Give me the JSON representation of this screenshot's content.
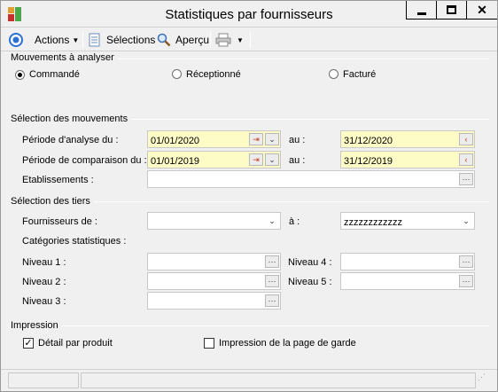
{
  "window": {
    "title": "Statistiques par fournisseurs"
  },
  "toolbar": {
    "actions_label": "Actions",
    "selections_label": "Sélections",
    "apercu_label": "Aperçu"
  },
  "mouvements_a_analyser": {
    "title": "Mouvements à analyser",
    "options": [
      {
        "label": "Commandé",
        "selected": true
      },
      {
        "label": "Réceptionné",
        "selected": false
      },
      {
        "label": "Facturé",
        "selected": false
      }
    ]
  },
  "selection_mouvements": {
    "title": "Sélection des mouvements",
    "periode_analyse_label": "Période d'analyse du :",
    "periode_analyse_from": "01/01/2020",
    "periode_analyse_au_label": "au :",
    "periode_analyse_to": "31/12/2020",
    "periode_comparaison_label": "Période de comparaison du :",
    "periode_comparaison_from": "01/01/2019",
    "periode_comparaison_au_label": "au :",
    "periode_comparaison_to": "31/12/2019",
    "etablissements_label": "Etablissements :",
    "etablissements_value": ""
  },
  "selection_tiers": {
    "title": "Sélection des tiers",
    "fournisseurs_label": "Fournisseurs de :",
    "fournisseurs_from": "",
    "fournisseurs_a_label": "à :",
    "fournisseurs_to": "zzzzzzzzzzzz",
    "categories_label": "Catégories statistiques :",
    "niveau1_label": "Niveau 1 :",
    "niveau2_label": "Niveau 2 :",
    "niveau3_label": "Niveau 3 :",
    "niveau4_label": "Niveau 4 :",
    "niveau5_label": "Niveau 5 :"
  },
  "impression": {
    "title": "Impression",
    "detail_label": "Détail par produit",
    "detail_checked": true,
    "page_garde_label": "Impression de la page de garde",
    "page_garde_checked": false
  }
}
